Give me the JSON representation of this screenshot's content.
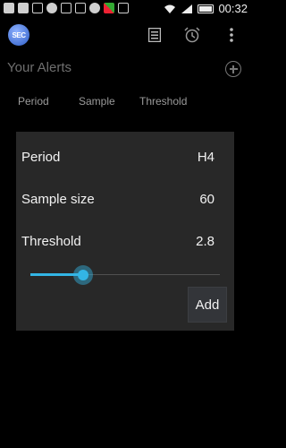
{
  "status_bar": {
    "time": "00:32",
    "icons": [
      "add-icon",
      "mail-icon",
      "pay-icon",
      "check-icon",
      "photo-icon",
      "terminal-icon",
      "spotify-icon",
      "store-icon",
      "code-icon",
      "wifi-icon",
      "signal-icon",
      "battery-icon"
    ]
  },
  "action_bar": {
    "logo_text": "SEC",
    "icons": [
      "list-icon",
      "alarm-icon",
      "overflow-menu-icon"
    ]
  },
  "page": {
    "title": "Your Alerts",
    "columns": [
      "Period",
      "Sample",
      "Threshold"
    ]
  },
  "dialog": {
    "period_label": "Period",
    "period_value": "H4",
    "sample_label": "Sample size",
    "sample_value": "60",
    "threshold_label": "Threshold",
    "threshold_value": "2.8",
    "slider_fraction": 0.28,
    "add_label": "Add"
  },
  "colors": {
    "accent": "#33b5e5",
    "background": "#000000",
    "dialog": "#282828"
  }
}
